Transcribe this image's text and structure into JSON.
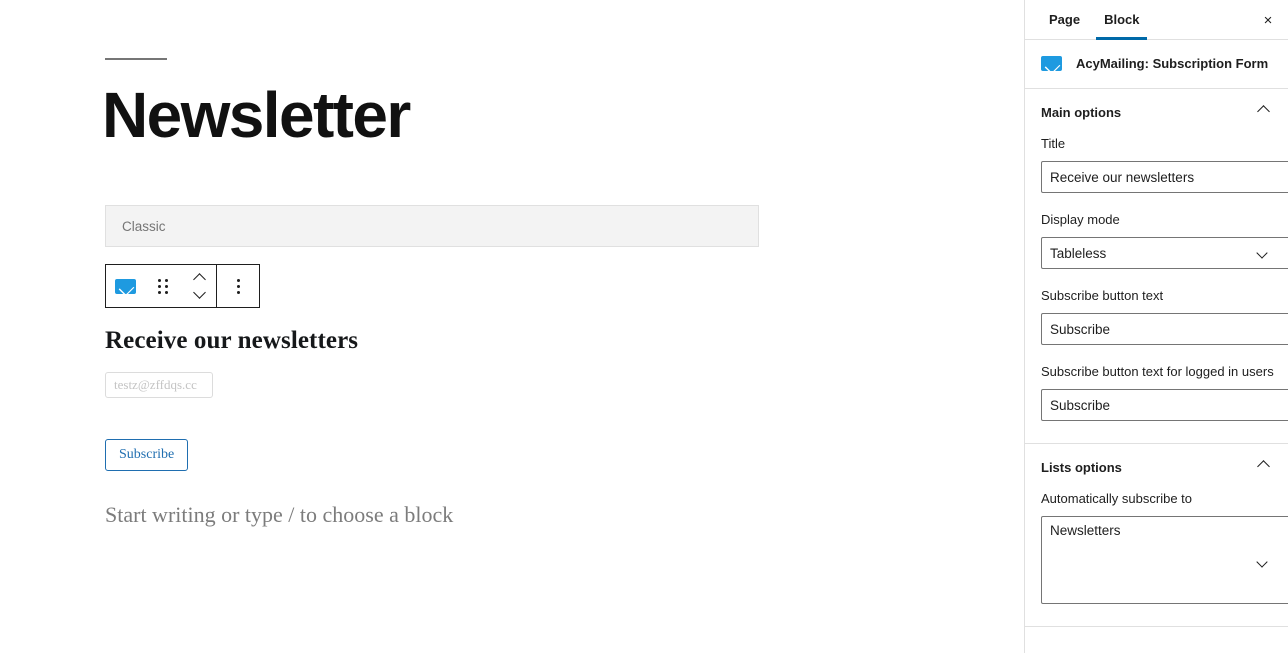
{
  "editor": {
    "post_title": "Newsletter",
    "classic_block": {
      "label": "Classic"
    },
    "block_toolbar": {
      "block_icon": "envelope-icon",
      "drag_handle": "drag-handle-icon",
      "move_up": "chevron-up-icon",
      "move_down": "chevron-down-icon",
      "more_options": "vertical-dots-icon"
    },
    "form_preview": {
      "heading": "Receive our newsletters",
      "email_placeholder": "testz@zffdqs.cc",
      "subscribe_label": "Subscribe"
    },
    "default_block_placeholder": "Start writing or type / to choose a block"
  },
  "sidebar": {
    "tabs": [
      {
        "label": "Page",
        "active": false
      },
      {
        "label": "Block",
        "active": true
      }
    ],
    "close_label": "×",
    "block_card": {
      "icon": "envelope-icon",
      "title": "AcyMailing: Subscription Form"
    },
    "panels": [
      {
        "title": "Main options",
        "expanded": true,
        "fields": [
          {
            "label": "Title",
            "type": "text",
            "value": "Receive our newsletters"
          },
          {
            "label": "Display mode",
            "type": "select",
            "value": "Tableless",
            "options": [
              "Tableless"
            ]
          },
          {
            "label": "Subscribe button text",
            "type": "text",
            "value": "Subscribe"
          },
          {
            "label": "Subscribe button text for logged in users",
            "type": "text",
            "value": "Subscribe"
          }
        ]
      },
      {
        "title": "Lists options",
        "expanded": true,
        "fields": [
          {
            "label": "Automatically subscribe to",
            "type": "listbox",
            "options": [
              "Newsletters"
            ]
          }
        ]
      }
    ]
  },
  "colors": {
    "accent_blue": "#0069a8",
    "brand_envelope": "#1e9ae0",
    "link_blue": "#1f6eb0",
    "border": "#e0e0e0",
    "text": "#1e1e1e",
    "muted": "#757575"
  }
}
